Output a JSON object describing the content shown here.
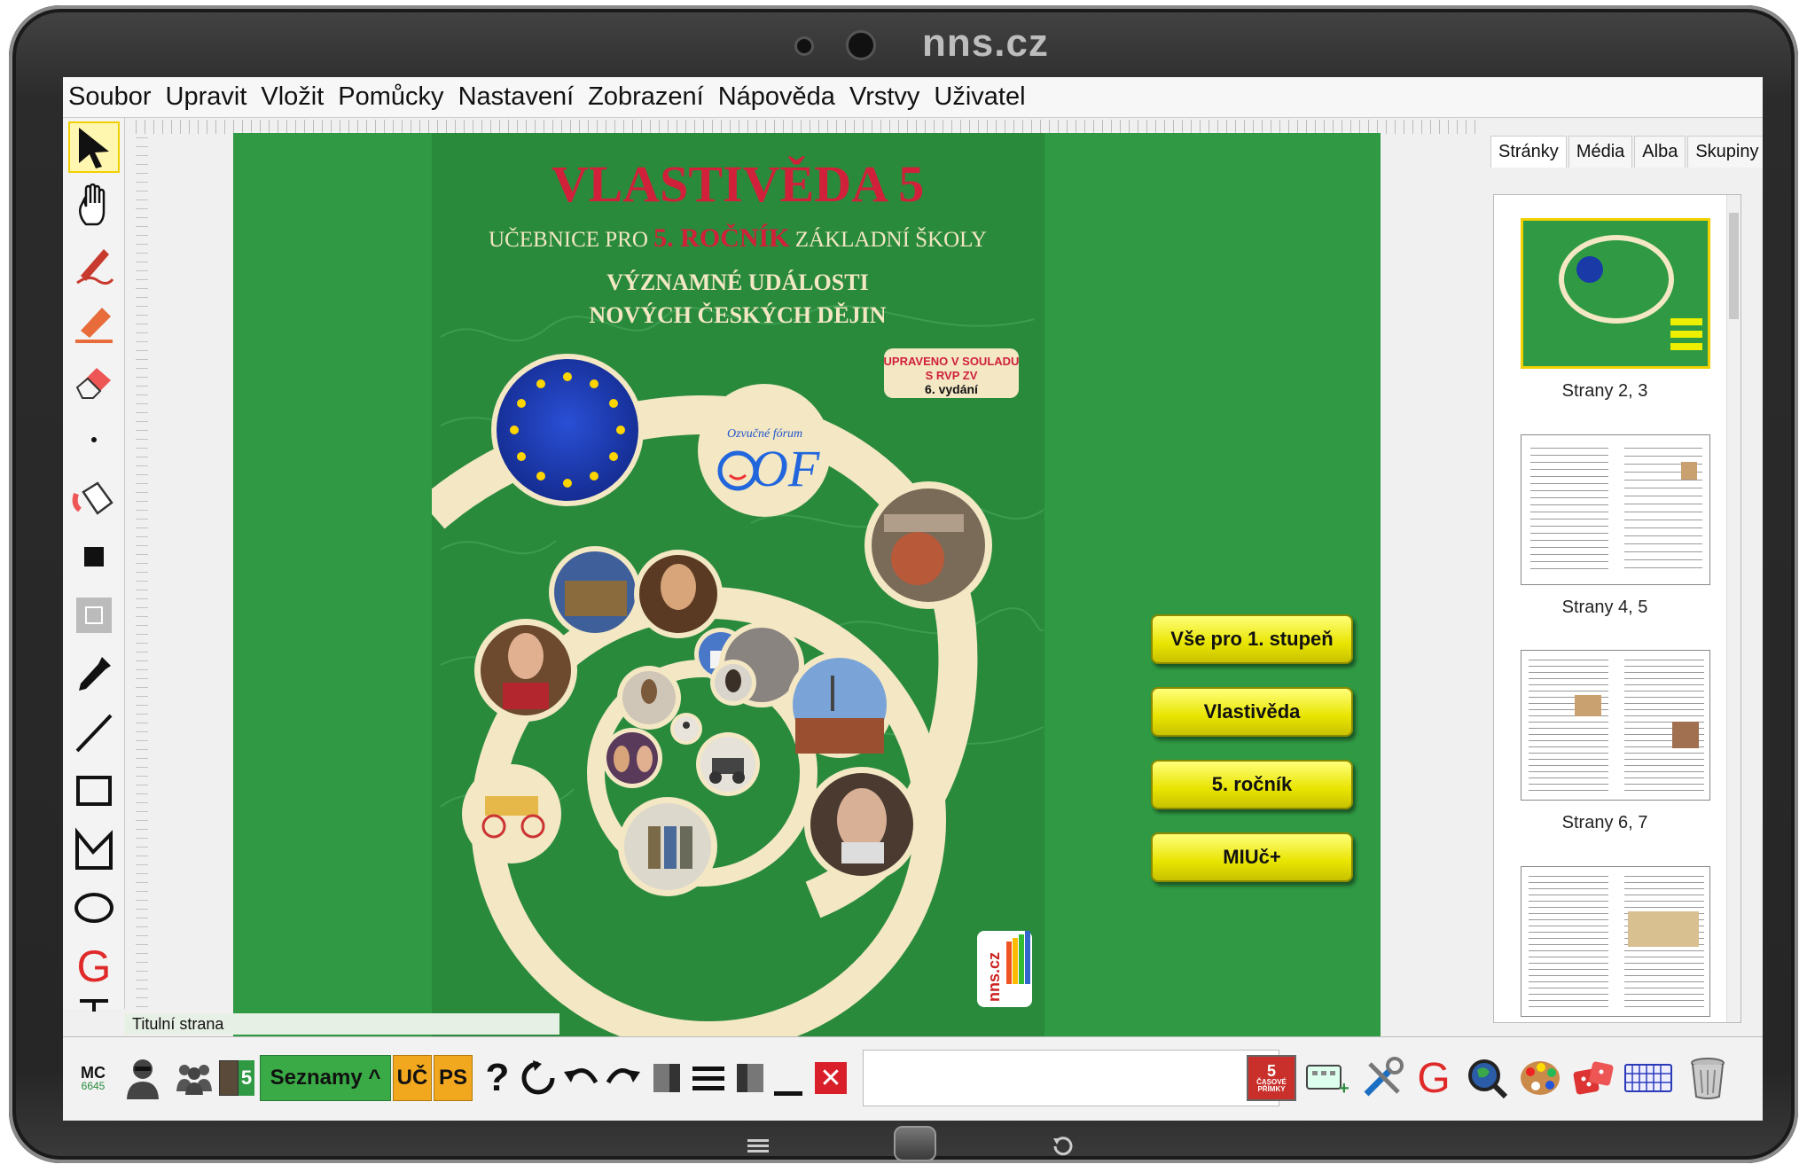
{
  "device": {
    "brand": "nns.cz"
  },
  "menu": [
    "Soubor",
    "Upravit",
    "Vložit",
    "Pomůcky",
    "Nastavení",
    "Zobrazení",
    "Nápověda",
    "Vrstvy",
    "Uživatel"
  ],
  "book": {
    "title": "VLASTIVĚDA 5",
    "subtitle_a": "UČEBNICE PRO ",
    "subtitle_num": "5. ROČNÍK",
    "subtitle_b": " ZÁKLADNÍ ŠKOLY",
    "line1": "VÝZNAMNÉ UDÁLOSTI",
    "line2": "NOVÝCH ČESKÝCH DĚJIN",
    "badge_1": "UPRAVENO V SOULADU",
    "badge_2": "S RVP ZV",
    "badge_3": "6. vydání",
    "publisher_arc": "Ozvučné fórum",
    "publisher_logo": "OF",
    "logo": "nns.cz"
  },
  "nav_buttons": [
    "Vše pro 1. stupeň",
    "Vlastivěda",
    "5. ročník",
    "MIUč+"
  ],
  "panel": {
    "tabs": [
      "Stránky",
      "Média",
      "Alba",
      "Skupiny"
    ],
    "thumbnails": [
      "Strany 2, 3",
      "Strany 4, 5",
      "Strany 6, 7"
    ]
  },
  "status": {
    "page_name": "Titulní strana"
  },
  "bottom": {
    "mc": "MC",
    "mc_num": "6645",
    "badge_num": "5",
    "seznamy": "Seznamy ^",
    "uc": "UČ",
    "ps": "PS",
    "help": "?",
    "casove_top": "5",
    "casove_bottom": "ČASOVÉ PŘÍMKY",
    "g_letter": "G"
  },
  "tools": {
    "g_letter": "G"
  },
  "colors": {
    "green": "#2f9a43",
    "title_red": "#d0203a",
    "accent_yellow": "#e8e400"
  }
}
